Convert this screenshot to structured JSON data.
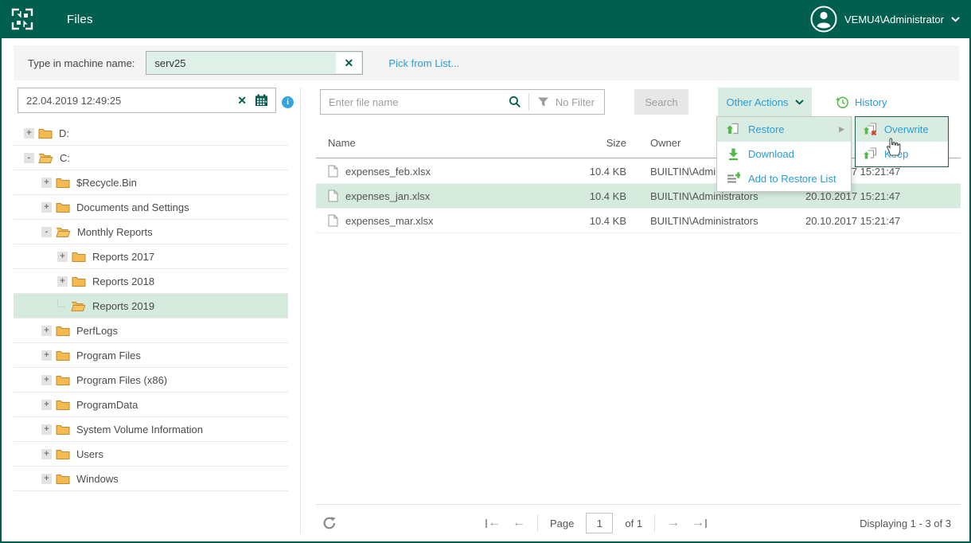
{
  "topbar": {
    "title": "Files",
    "user": "VEMU4\\Administrator"
  },
  "machine_bar": {
    "label": "Type in machine name:",
    "value": "serv25",
    "pick_from_list": "Pick from List..."
  },
  "left_panel": {
    "date_value": "22.04.2019 12:49:25",
    "tree": [
      {
        "label": "D:",
        "level": 1,
        "expander": "+",
        "open": false,
        "selected": false
      },
      {
        "label": "C:",
        "level": 1,
        "expander": "-",
        "open": true,
        "selected": false
      },
      {
        "label": "$Recycle.Bin",
        "level": 2,
        "expander": "+",
        "open": false,
        "selected": false
      },
      {
        "label": "Documents and Settings",
        "level": 2,
        "expander": "+",
        "open": false,
        "selected": false
      },
      {
        "label": "Monthly Reports",
        "level": 2,
        "expander": "-",
        "open": true,
        "selected": false
      },
      {
        "label": "Reports 2017",
        "level": 3,
        "expander": "+",
        "open": false,
        "selected": false
      },
      {
        "label": "Reports 2018",
        "level": 3,
        "expander": "+",
        "open": false,
        "selected": false
      },
      {
        "label": "Reports 2019",
        "level": 3,
        "expander": "",
        "open": true,
        "selected": true
      },
      {
        "label": "PerfLogs",
        "level": 2,
        "expander": "+",
        "open": false,
        "selected": false
      },
      {
        "label": "Program Files",
        "level": 2,
        "expander": "+",
        "open": false,
        "selected": false
      },
      {
        "label": "Program Files (x86)",
        "level": 2,
        "expander": "+",
        "open": false,
        "selected": false
      },
      {
        "label": "ProgramData",
        "level": 2,
        "expander": "+",
        "open": false,
        "selected": false
      },
      {
        "label": "System Volume Information",
        "level": 2,
        "expander": "+",
        "open": false,
        "selected": false
      },
      {
        "label": "Users",
        "level": 2,
        "expander": "+",
        "open": false,
        "selected": false
      },
      {
        "label": "Windows",
        "level": 2,
        "expander": "+",
        "open": false,
        "selected": false
      }
    ]
  },
  "toolbar": {
    "file_search_placeholder": "Enter file name",
    "filter_label": "No Filter",
    "search_button": "Search",
    "other_actions": "Other Actions",
    "history": "History"
  },
  "table": {
    "headers": {
      "name": "Name",
      "size": "Size",
      "owner": "Owner"
    },
    "rows": [
      {
        "name": "expenses_feb.xlsx",
        "size": "10.4 KB",
        "owner": "BUILTIN\\Administrators",
        "date": "20.10.2017 15:21:47",
        "selected": false
      },
      {
        "name": "expenses_jan.xlsx",
        "size": "10.4 KB",
        "owner": "BUILTIN\\Administrators",
        "date": "20.10.2017 15:21:47",
        "selected": true
      },
      {
        "name": "expenses_mar.xlsx",
        "size": "10.4 KB",
        "owner": "BUILTIN\\Administrators",
        "date": "20.10.2017 15:21:47",
        "selected": false
      }
    ]
  },
  "menu": {
    "restore": "Restore",
    "download": "Download",
    "add_to_restore_list": "Add to Restore List",
    "submenu": {
      "overwrite": "Overwrite",
      "keep": "Keep"
    }
  },
  "pagination": {
    "page_label": "Page",
    "page_value": "1",
    "of_label": "of 1",
    "displaying": "Displaying 1 - 3 of 3",
    "first": "←",
    "prev": "←",
    "next": "→",
    "last": "→"
  },
  "glyphs": {
    "clear": "✕",
    "info": "i",
    "submenu_caret": "▶"
  },
  "colors": {
    "brand_green": "#005F4E",
    "accent_green": "#54B948",
    "link_blue": "#2B9CD8",
    "highlight_green": "#D5EBDE",
    "folder_yellow": "#F2BA4F",
    "danger_red": "#D93A2B"
  }
}
